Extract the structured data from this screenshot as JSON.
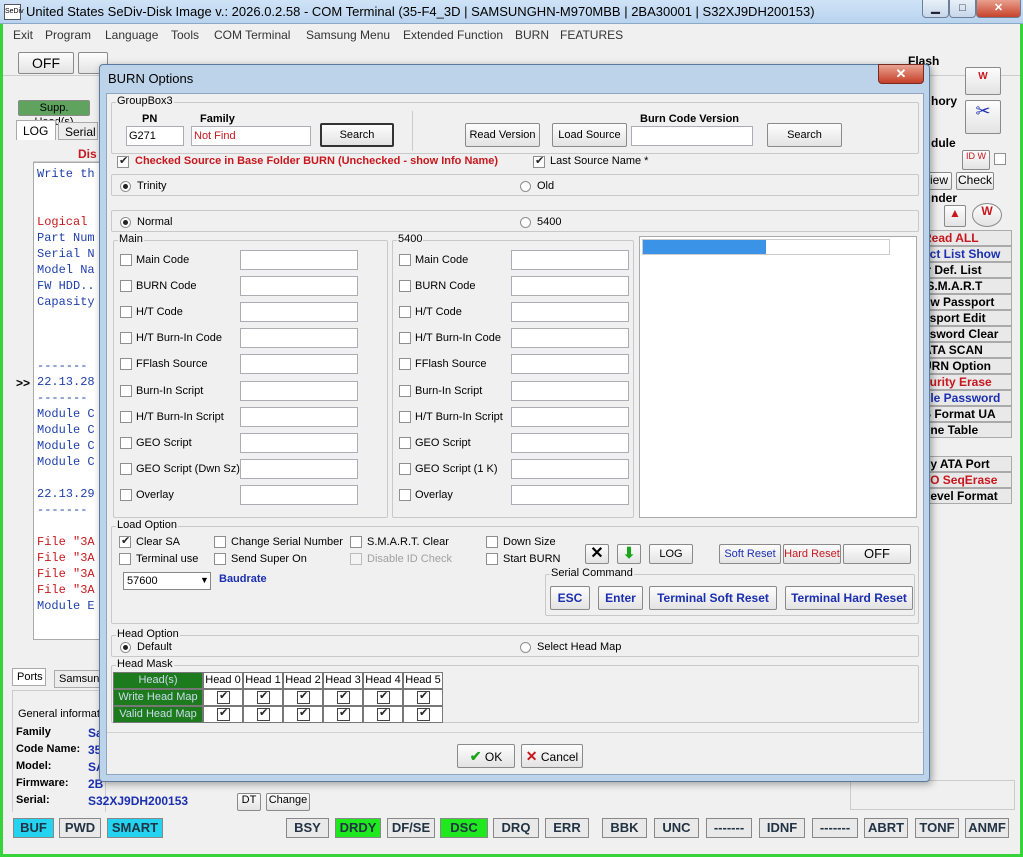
{
  "window": {
    "icon_text": "SeDiv",
    "title": "United States  SeDiv-Disk Image v.: 2026.0.2.58 - COM Terminal  (35-F4_3D | SAMSUNGHN-M970MBB | 2BA30001 | S32XJ9DH200153)",
    "min": "▁",
    "max": "□",
    "close": "✕"
  },
  "menu": [
    "Exit",
    "Program",
    "Language",
    "Tools",
    "COM Terminal",
    "Samsung Menu",
    "Extended Function",
    "BURN",
    "FEATURES"
  ],
  "toolbar": {
    "off": "OFF",
    "flash": "Flash"
  },
  "left": {
    "tab_supp": "Supp. Head(s)",
    "tab_log": "LOG",
    "tab_serial": "Serial L",
    "dis": "Dis",
    "expand": ">>",
    "lines": [
      "Write th",
      "",
      "",
      "Logical",
      "Part Num",
      "Serial N",
      "Model Na",
      "FW HDD..",
      "Capasity",
      "",
      "",
      "",
      "-------",
      "22.13.28",
      "-------",
      "Module C",
      "Module C",
      "Module C",
      "Module C",
      "",
      "22.13.29",
      "-------",
      "",
      "File \"3A",
      "File \"3A",
      "File \"3A",
      "File \"3A",
      "Module E"
    ]
  },
  "right": {
    "hory": "hory",
    "dule": "dule",
    "view": "iew",
    "check": "Check",
    "nder": "nder",
    "items": [
      {
        "t": "Read ALL",
        "c": "#c8161d"
      },
      {
        "t": "ect List Show",
        "c": "#1b2fb0"
      },
      {
        "t": "lr Def. List",
        "c": "#000"
      },
      {
        "t": "S.M.A.R.T.",
        "c": "#000"
      },
      {
        "t": "ow Passport",
        "c": "#000"
      },
      {
        "t": "ssport Edit",
        "c": "#000"
      },
      {
        "t": "ssword Clear",
        "c": "#000"
      },
      {
        "t": "ATA SCAN",
        "c": "#000"
      },
      {
        "t": "URN Option",
        "c": "#000"
      },
      {
        "t": "curity Erase",
        "c": "#c8161d"
      },
      {
        "t": "ble Password",
        "c": "#1b2fb0"
      },
      {
        "t": "S Format UA",
        "c": "#000"
      },
      {
        "t": "one Table",
        "c": "#000"
      }
    ],
    "items2": [
      {
        "t": "ny ATA Port",
        "c": "#000"
      },
      {
        "t": "TO SeqErase",
        "c": "#c8161d"
      },
      {
        "t": "Level Format",
        "c": "#000"
      }
    ]
  },
  "bottom": {
    "tab_ports": "Ports",
    "tab_samsung": "Samsun",
    "general": "General informat",
    "labels": [
      "Family",
      "Code Name:",
      "Model:",
      "Firmware:",
      "Serial:"
    ],
    "vals": [
      "Sa",
      "35",
      "SA",
      "2B",
      "S32XJ9DH200153"
    ],
    "dt": "DT",
    "change": "Change"
  },
  "statusbar": [
    "BUF",
    "PWD",
    "SMART",
    "BSY",
    "DRDY",
    "DF/SE",
    "DSC",
    "DRQ",
    "ERR",
    "BBK",
    "UNC",
    "-------",
    "IDNF",
    "-------",
    "ABRT",
    "TONF",
    "ANMF"
  ],
  "dialog": {
    "title": "BURN Options",
    "close": "✕",
    "groupbox3": "GroupBox3",
    "pn_label": "PN",
    "pn_value": "G271",
    "family_label": "Family",
    "family_value": "Not Find",
    "search": "Search",
    "read_version": "Read Version",
    "load_source": "Load Source",
    "burn_code_version_label": "Burn Code Version",
    "burn_code_version_value": "",
    "search2": "Search",
    "checked_source": "Checked Source in Base Folder BURN (Unchecked - show Info Name)",
    "last_source": "Last Source Name *",
    "trinity": "Trinity",
    "old": "Old",
    "normal": "Normal",
    "r5400": "5400",
    "main_group": "Main",
    "g5400": "5400",
    "main_items": [
      "Main Code",
      "BURN Code",
      "H/T Code",
      "H/T Burn-In Code",
      "FFlash Source",
      "Burn-In Script",
      "H/T Burn-In Script",
      "GEO Script",
      "GEO Script (Dwn Sz)",
      "Overlay"
    ],
    "g5400_items": [
      "Main Code",
      "BURN Code",
      "H/T Code",
      "H/T Burn-In Code",
      "FFlash Source",
      "Burn-In Script",
      "H/T Burn-In Script",
      "GEO Script",
      "GEO Script (1 K)",
      "Overlay"
    ],
    "load_option": "Load Option",
    "clear_sa": "Clear SA",
    "terminal_use": "Terminal use",
    "change_serial": "Change Serial Number",
    "send_super": "Send Super On",
    "smart_clear": "S.M.A.R.T. Clear",
    "disable_id": "Disable ID Check",
    "down_size": "Down Size",
    "start_burn": "Start BURN",
    "baud_value": "57600",
    "baudrate": "Baudrate",
    "log": "LOG",
    "soft_reset": "Soft Reset",
    "hard_reset": "Hard Reset",
    "off": "OFF",
    "serial_command": "Serial Command",
    "esc": "ESC",
    "enter": "Enter",
    "terminal_soft": "Terminal Soft Reset",
    "terminal_hard": "Terminal Hard Reset",
    "head_option": "Head Option",
    "default": "Default",
    "select_head_map": "Select Head Map",
    "head_mask": "Head Mask",
    "heads_header": "Head(s)",
    "heads": [
      "Head 0",
      "Head 1",
      "Head 2",
      "Head 3",
      "Head 4",
      "Head 5"
    ],
    "write_head_map": "Write Head Map",
    "valid_head_map": "Valid Head Map",
    "ok": "OK",
    "cancel": "Cancel",
    "progress_fraction": 0.5
  }
}
